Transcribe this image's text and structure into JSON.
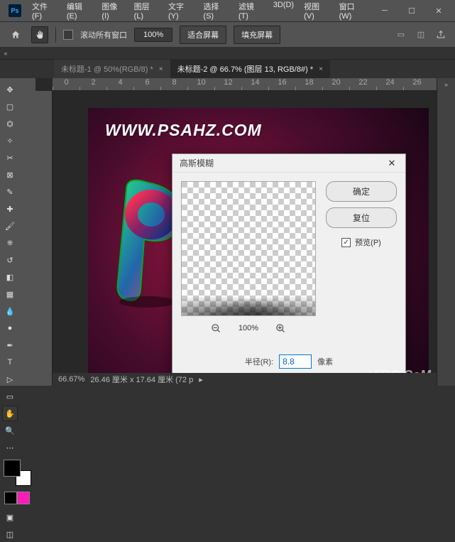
{
  "menu": [
    "文件(F)",
    "编辑(E)",
    "图像(I)",
    "图层(L)",
    "文字(Y)",
    "选择(S)",
    "滤镜(T)",
    "3D(D)",
    "视图(V)",
    "窗口(W)"
  ],
  "options": {
    "scroll_all": "滚动所有窗口",
    "zoom": "100%",
    "fit": "适合屏幕",
    "fill": "填充屏幕"
  },
  "tabs": [
    {
      "label": "未标题-1 @ 50%(RGB/8) *",
      "active": false
    },
    {
      "label": "未标题-2 @ 66.7% (图层 13, RGB/8#) *",
      "active": true
    }
  ],
  "ruler": [
    "0",
    "2",
    "4",
    "6",
    "8",
    "10",
    "12",
    "14",
    "16",
    "18",
    "20",
    "22",
    "24",
    "26"
  ],
  "canvas": {
    "url_text": "WWW.PSAHZ.COM"
  },
  "dialog": {
    "title": "高斯模糊",
    "ok": "确定",
    "reset": "复位",
    "preview": "预览(P)",
    "preview_checked": true,
    "zoom": "100%",
    "radius_label": "半径(R):",
    "radius_value": "8.8",
    "unit": "像素"
  },
  "status": {
    "zoom": "66.67%",
    "dims": "26.46 厘米 x 17.64 厘米 (72 p"
  },
  "swatch2": "#ff1ab9",
  "watermark": "UiBQ.CoM"
}
